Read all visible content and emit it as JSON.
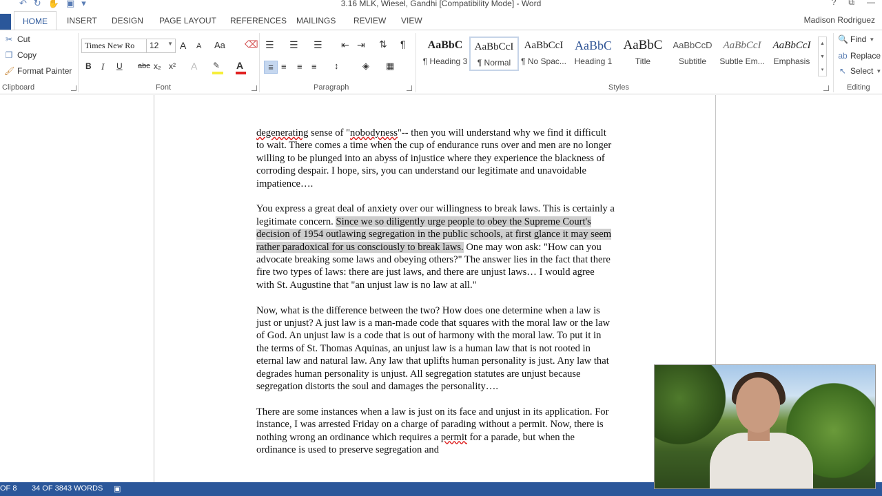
{
  "window": {
    "title": "3.16 MLK, Wiesel, Gandhi [Compatibility Mode] - Word",
    "help": "?",
    "restore_ribbon": "⧉",
    "minimize": "—"
  },
  "qat": {
    "undo": "↶",
    "redo": "↻",
    "touch": "✋",
    "print": "▣",
    "more": "▾"
  },
  "tabs": [
    "HOME",
    "INSERT",
    "DESIGN",
    "PAGE LAYOUT",
    "REFERENCES",
    "MAILINGS",
    "REVIEW",
    "VIEW"
  ],
  "user": "Madison Rodriguez",
  "clipboard": {
    "cut": "Cut",
    "copy": "Copy",
    "format_painter": "Format Painter",
    "label": "Clipboard"
  },
  "font": {
    "name": "Times New Ro",
    "size": "12",
    "grow": "A",
    "shrink": "A",
    "case": "Aa",
    "bold": "B",
    "italic": "I",
    "underline": "U",
    "strike": "abc",
    "subscript": "x₂",
    "superscript": "x²",
    "color_letter": "A",
    "label": "Font"
  },
  "paragraph": {
    "label": "Paragraph",
    "pilcrow": "¶",
    "sort": "⇅"
  },
  "styles": {
    "label": "Styles",
    "items": [
      {
        "sample": "AaBbC",
        "name": "¶ Heading 3"
      },
      {
        "sample": "AaBbCcI",
        "name": "¶ Normal"
      },
      {
        "sample": "AaBbCcI",
        "name": "¶ No Spac..."
      },
      {
        "sample": "AaBbC",
        "name": "Heading 1"
      },
      {
        "sample": "AaBbC",
        "name": "Title"
      },
      {
        "sample": "AaBbCcD",
        "name": "Subtitle"
      },
      {
        "sample": "AaBbCcI",
        "name": "Subtle Em..."
      },
      {
        "sample": "AaBbCcI",
        "name": "Emphasis"
      }
    ]
  },
  "editing": {
    "find": "Find",
    "replace": "Replace",
    "select": "Select",
    "label": "Editing"
  },
  "document": {
    "p1": {
      "w1": "degenerating",
      "t1": " sense of \"",
      "w2": "nobodyness",
      "t2": "\"-- then you will understand why we find it difficult to wait. There comes a time when the cup of endurance runs over and men are no longer willing to be plunged into an abyss of injustice where they experience the blackness of corroding despair. I hope, sirs, you can understand our legitimate and unavoidable impatience…."
    },
    "p2": {
      "before": "You express a great deal of anxiety over our willingness to break laws. This is certainly a legitimate concern. ",
      "highlight": "Since we so diligently urge people to obey the Supreme Court's decision of 1954 outlawing segregation in the public schools, at first glance it may seem rather paradoxical for us consciously to break laws.",
      "after": " One may won ask: \"How can you advocate breaking some laws and obeying others?\" The answer lies in the fact that there fire two types of laws: there are just laws, and there are unjust laws… I would agree with St. Augustine that \"an unjust law is no law at all.\""
    },
    "p3": "Now, what is the difference between the two? How does one determine when a law is just or unjust? A just law is a man-made code that squares with the moral law or the law of God. An unjust law is a code that is out of harmony with the moral law. To put it in the terms of St. Thomas Aquinas, an unjust law is a human law that is not rooted in eternal law and natural law. Any law that uplifts human personality is just. Any law that degrades human personality is unjust. All segregation statutes are unjust because segregation distorts the soul and damages the personality….",
    "p4": {
      "t1": "There are some instances when a law is just on its face and unjust in its application. For instance, I was arrested Friday on a charge of parading without a permit. Now, there is nothing wrong an ordinance which requires a ",
      "w1": "permit",
      "t2": " for a parade, but when the ordinance is used to preserve segregation and"
    }
  },
  "status": {
    "page": "OF 8",
    "words": "34 OF 3843 WORDS"
  }
}
